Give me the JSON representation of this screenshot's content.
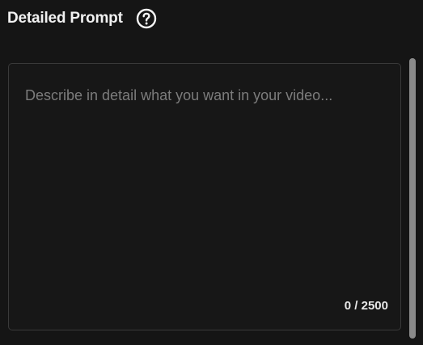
{
  "header": {
    "title": "Detailed Prompt",
    "help_icon": "question-circle-icon"
  },
  "prompt": {
    "value": "",
    "placeholder": "Describe in detail what you want in your video...",
    "counter": "0 / 2500"
  },
  "colors": {
    "background": "#151515",
    "text": "#f1f1f1",
    "placeholder": "#7c7c7c",
    "border": "#3a3a3a",
    "scroll_thumb": "#8a8a8a"
  }
}
